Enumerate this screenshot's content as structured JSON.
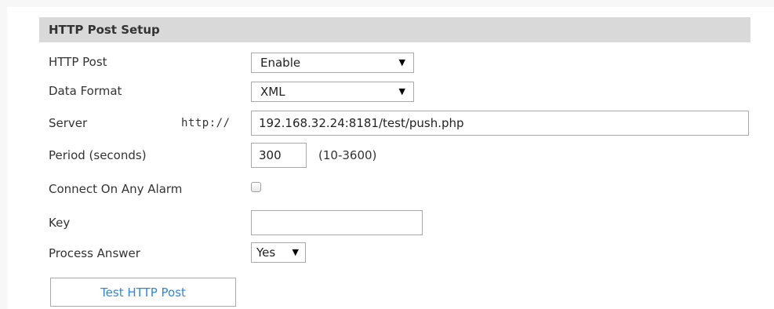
{
  "section": {
    "title": "HTTP Post Setup"
  },
  "http_post": {
    "label": "HTTP Post",
    "value": "Enable"
  },
  "data_format": {
    "label": "Data Format",
    "value": "XML"
  },
  "server": {
    "label": "Server",
    "prefix": "http://",
    "value": "192.168.32.24:8181/test/push.php"
  },
  "period": {
    "label": "Period (seconds)",
    "value": "300",
    "range": "(10-3600)"
  },
  "connect_on_alarm": {
    "label": "Connect On Any Alarm",
    "checked": false
  },
  "key": {
    "label": "Key",
    "value": ""
  },
  "process_answer": {
    "label": "Process Answer",
    "value": "Yes"
  },
  "test_button": {
    "label": "Test HTTP Post"
  },
  "icons": {
    "dropdown": "dropdown-arrow-icon",
    "arrow_glyph": "▼"
  },
  "colors": {
    "header_bg": "#d9d9d9",
    "button_text": "#2e86de",
    "border": "#a9a9a9"
  }
}
